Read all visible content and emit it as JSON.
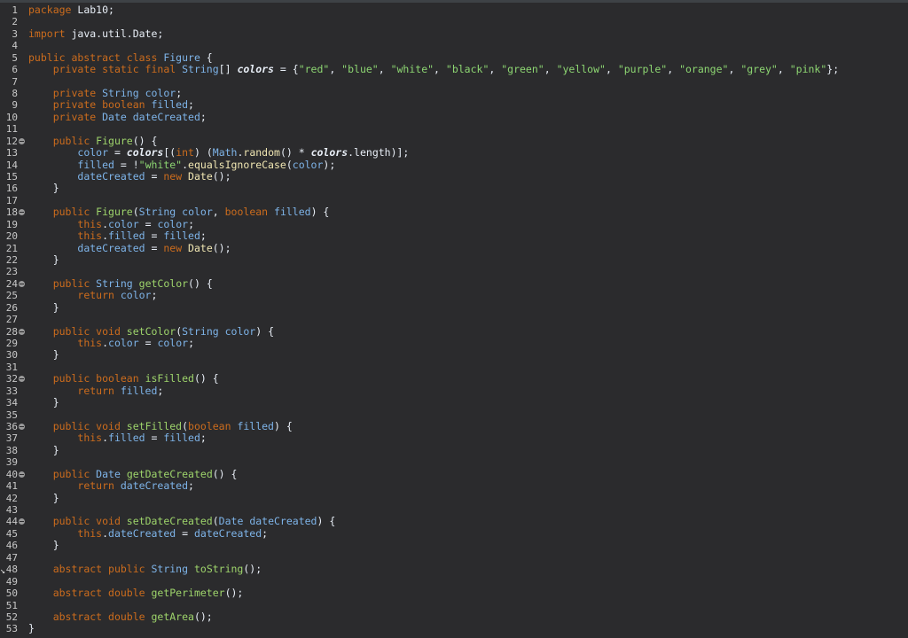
{
  "editor": {
    "lines": [
      {
        "n": "1",
        "fold": false,
        "indent": "",
        "segs": [
          [
            "kw",
            "package"
          ],
          [
            "plain",
            " Lab10;"
          ]
        ]
      },
      {
        "n": "2",
        "fold": false,
        "indent": "",
        "segs": []
      },
      {
        "n": "3",
        "fold": false,
        "indent": "",
        "segs": [
          [
            "kw",
            "import"
          ],
          [
            "plain",
            " java.util.Date;"
          ]
        ]
      },
      {
        "n": "4",
        "fold": false,
        "indent": "",
        "segs": []
      },
      {
        "n": "5",
        "fold": false,
        "indent": "",
        "segs": [
          [
            "kw",
            "public abstract class "
          ],
          [
            "type",
            "Figure"
          ],
          [
            "plain",
            " {"
          ]
        ]
      },
      {
        "n": "6",
        "fold": false,
        "indent": "    ",
        "segs": [
          [
            "kw",
            "private static final "
          ],
          [
            "type",
            "String"
          ],
          [
            "plain",
            "[] "
          ],
          [
            "sfield",
            "colors"
          ],
          [
            "plain",
            " = {"
          ],
          [
            "str",
            "\"red\""
          ],
          [
            "plain",
            ", "
          ],
          [
            "str",
            "\"blue\""
          ],
          [
            "plain",
            ", "
          ],
          [
            "str",
            "\"white\""
          ],
          [
            "plain",
            ", "
          ],
          [
            "str",
            "\"black\""
          ],
          [
            "plain",
            ", "
          ],
          [
            "str",
            "\"green\""
          ],
          [
            "plain",
            ", "
          ],
          [
            "str",
            "\"yellow\""
          ],
          [
            "plain",
            ", "
          ],
          [
            "str",
            "\"purple\""
          ],
          [
            "plain",
            ", "
          ],
          [
            "str",
            "\"orange\""
          ],
          [
            "plain",
            ", "
          ],
          [
            "str",
            "\"grey\""
          ],
          [
            "plain",
            ", "
          ],
          [
            "str",
            "\"pink\""
          ],
          [
            "plain",
            "};"
          ]
        ]
      },
      {
        "n": "7",
        "fold": false,
        "indent": "",
        "segs": []
      },
      {
        "n": "8",
        "fold": false,
        "indent": "    ",
        "segs": [
          [
            "kw",
            "private "
          ],
          [
            "type",
            "String"
          ],
          [
            "plain",
            " "
          ],
          [
            "var",
            "color"
          ],
          [
            "plain",
            ";"
          ]
        ]
      },
      {
        "n": "9",
        "fold": false,
        "indent": "    ",
        "segs": [
          [
            "kw",
            "private boolean "
          ],
          [
            "var",
            "filled"
          ],
          [
            "plain",
            ";"
          ]
        ]
      },
      {
        "n": "10",
        "fold": false,
        "indent": "    ",
        "segs": [
          [
            "kw",
            "private "
          ],
          [
            "type",
            "Date"
          ],
          [
            "plain",
            " "
          ],
          [
            "var",
            "dateCreated"
          ],
          [
            "plain",
            ";"
          ]
        ]
      },
      {
        "n": "11",
        "fold": false,
        "indent": "",
        "segs": []
      },
      {
        "n": "12",
        "fold": true,
        "indent": "    ",
        "segs": [
          [
            "kw",
            "public "
          ],
          [
            "fn",
            "Figure"
          ],
          [
            "plain",
            "() {"
          ]
        ]
      },
      {
        "n": "13",
        "fold": false,
        "indent": "        ",
        "segs": [
          [
            "var",
            "color"
          ],
          [
            "plain",
            " = "
          ],
          [
            "sfield",
            "colors"
          ],
          [
            "plain",
            "[("
          ],
          [
            "kw",
            "int"
          ],
          [
            "plain",
            ") ("
          ],
          [
            "type",
            "Math"
          ],
          [
            "plain",
            "."
          ],
          [
            "call",
            "random"
          ],
          [
            "plain",
            "() * "
          ],
          [
            "sfield",
            "colors"
          ],
          [
            "plain",
            ".length)];"
          ]
        ]
      },
      {
        "n": "14",
        "fold": false,
        "indent": "        ",
        "segs": [
          [
            "var",
            "filled"
          ],
          [
            "plain",
            " = !"
          ],
          [
            "str",
            "\"white\""
          ],
          [
            "plain",
            "."
          ],
          [
            "call",
            "equalsIgnoreCase"
          ],
          [
            "plain",
            "("
          ],
          [
            "var",
            "color"
          ],
          [
            "plain",
            ");"
          ]
        ]
      },
      {
        "n": "15",
        "fold": false,
        "indent": "        ",
        "segs": [
          [
            "var",
            "dateCreated"
          ],
          [
            "plain",
            " = "
          ],
          [
            "kw",
            "new "
          ],
          [
            "call",
            "Date"
          ],
          [
            "plain",
            "();"
          ]
        ]
      },
      {
        "n": "16",
        "fold": false,
        "indent": "    ",
        "segs": [
          [
            "plain",
            "}"
          ]
        ]
      },
      {
        "n": "17",
        "fold": false,
        "indent": "",
        "segs": []
      },
      {
        "n": "18",
        "fold": true,
        "indent": "    ",
        "segs": [
          [
            "kw",
            "public "
          ],
          [
            "fn",
            "Figure"
          ],
          [
            "plain",
            "("
          ],
          [
            "type",
            "String"
          ],
          [
            "plain",
            " "
          ],
          [
            "var",
            "color"
          ],
          [
            "plain",
            ", "
          ],
          [
            "kw",
            "boolean "
          ],
          [
            "var",
            "filled"
          ],
          [
            "plain",
            ") {"
          ]
        ]
      },
      {
        "n": "19",
        "fold": false,
        "indent": "        ",
        "segs": [
          [
            "kw",
            "this"
          ],
          [
            "plain",
            "."
          ],
          [
            "var",
            "color"
          ],
          [
            "plain",
            " = "
          ],
          [
            "var",
            "color"
          ],
          [
            "plain",
            ";"
          ]
        ]
      },
      {
        "n": "20",
        "fold": false,
        "indent": "        ",
        "segs": [
          [
            "kw",
            "this"
          ],
          [
            "plain",
            "."
          ],
          [
            "var",
            "filled"
          ],
          [
            "plain",
            " = "
          ],
          [
            "var",
            "filled"
          ],
          [
            "plain",
            ";"
          ]
        ]
      },
      {
        "n": "21",
        "fold": false,
        "indent": "        ",
        "segs": [
          [
            "var",
            "dateCreated"
          ],
          [
            "plain",
            " = "
          ],
          [
            "kw",
            "new "
          ],
          [
            "call",
            "Date"
          ],
          [
            "plain",
            "();"
          ]
        ]
      },
      {
        "n": "22",
        "fold": false,
        "indent": "    ",
        "segs": [
          [
            "plain",
            "}"
          ]
        ]
      },
      {
        "n": "23",
        "fold": false,
        "indent": "",
        "segs": []
      },
      {
        "n": "24",
        "fold": true,
        "indent": "    ",
        "segs": [
          [
            "kw",
            "public "
          ],
          [
            "type",
            "String"
          ],
          [
            "plain",
            " "
          ],
          [
            "fn",
            "getColor"
          ],
          [
            "plain",
            "() {"
          ]
        ]
      },
      {
        "n": "25",
        "fold": false,
        "indent": "        ",
        "segs": [
          [
            "kw",
            "return "
          ],
          [
            "var",
            "color"
          ],
          [
            "plain",
            ";"
          ]
        ]
      },
      {
        "n": "26",
        "fold": false,
        "indent": "    ",
        "segs": [
          [
            "plain",
            "}"
          ]
        ]
      },
      {
        "n": "27",
        "fold": false,
        "indent": "",
        "segs": []
      },
      {
        "n": "28",
        "fold": true,
        "indent": "    ",
        "segs": [
          [
            "kw",
            "public void "
          ],
          [
            "fn",
            "setColor"
          ],
          [
            "plain",
            "("
          ],
          [
            "type",
            "String"
          ],
          [
            "plain",
            " "
          ],
          [
            "var",
            "color"
          ],
          [
            "plain",
            ") {"
          ]
        ]
      },
      {
        "n": "29",
        "fold": false,
        "indent": "        ",
        "segs": [
          [
            "kw",
            "this"
          ],
          [
            "plain",
            "."
          ],
          [
            "var",
            "color"
          ],
          [
            "plain",
            " = "
          ],
          [
            "var",
            "color"
          ],
          [
            "plain",
            ";"
          ]
        ]
      },
      {
        "n": "30",
        "fold": false,
        "indent": "    ",
        "segs": [
          [
            "plain",
            "}"
          ]
        ]
      },
      {
        "n": "31",
        "fold": false,
        "indent": "",
        "segs": []
      },
      {
        "n": "32",
        "fold": true,
        "indent": "    ",
        "segs": [
          [
            "kw",
            "public boolean "
          ],
          [
            "fn",
            "isFilled"
          ],
          [
            "plain",
            "() {"
          ]
        ]
      },
      {
        "n": "33",
        "fold": false,
        "indent": "        ",
        "segs": [
          [
            "kw",
            "return "
          ],
          [
            "var",
            "filled"
          ],
          [
            "plain",
            ";"
          ]
        ]
      },
      {
        "n": "34",
        "fold": false,
        "indent": "    ",
        "segs": [
          [
            "plain",
            "}"
          ]
        ]
      },
      {
        "n": "35",
        "fold": false,
        "indent": "",
        "segs": []
      },
      {
        "n": "36",
        "fold": true,
        "indent": "    ",
        "segs": [
          [
            "kw",
            "public void "
          ],
          [
            "fn",
            "setFilled"
          ],
          [
            "plain",
            "("
          ],
          [
            "kw",
            "boolean "
          ],
          [
            "var",
            "filled"
          ],
          [
            "plain",
            ") {"
          ]
        ]
      },
      {
        "n": "37",
        "fold": false,
        "indent": "        ",
        "segs": [
          [
            "kw",
            "this"
          ],
          [
            "plain",
            "."
          ],
          [
            "var",
            "filled"
          ],
          [
            "plain",
            " = "
          ],
          [
            "var",
            "filled"
          ],
          [
            "plain",
            ";"
          ]
        ]
      },
      {
        "n": "38",
        "fold": false,
        "indent": "    ",
        "segs": [
          [
            "plain",
            "}"
          ]
        ]
      },
      {
        "n": "39",
        "fold": false,
        "indent": "",
        "segs": []
      },
      {
        "n": "40",
        "fold": true,
        "indent": "    ",
        "segs": [
          [
            "kw",
            "public "
          ],
          [
            "type",
            "Date"
          ],
          [
            "plain",
            " "
          ],
          [
            "fn",
            "getDateCreated"
          ],
          [
            "plain",
            "() {"
          ]
        ]
      },
      {
        "n": "41",
        "fold": false,
        "indent": "        ",
        "segs": [
          [
            "kw",
            "return "
          ],
          [
            "var",
            "dateCreated"
          ],
          [
            "plain",
            ";"
          ]
        ]
      },
      {
        "n": "42",
        "fold": false,
        "indent": "    ",
        "segs": [
          [
            "plain",
            "}"
          ]
        ]
      },
      {
        "n": "43",
        "fold": false,
        "indent": "",
        "segs": []
      },
      {
        "n": "44",
        "fold": true,
        "indent": "    ",
        "segs": [
          [
            "kw",
            "public void "
          ],
          [
            "fn",
            "setDateCreated"
          ],
          [
            "plain",
            "("
          ],
          [
            "type",
            "Date"
          ],
          [
            "plain",
            " "
          ],
          [
            "var",
            "dateCreated"
          ],
          [
            "plain",
            ") {"
          ]
        ]
      },
      {
        "n": "45",
        "fold": false,
        "indent": "        ",
        "segs": [
          [
            "kw",
            "this"
          ],
          [
            "plain",
            "."
          ],
          [
            "var",
            "dateCreated"
          ],
          [
            "plain",
            " = "
          ],
          [
            "var",
            "dateCreated"
          ],
          [
            "plain",
            ";"
          ]
        ]
      },
      {
        "n": "46",
        "fold": false,
        "indent": "    ",
        "segs": [
          [
            "plain",
            "}"
          ]
        ]
      },
      {
        "n": "47",
        "fold": false,
        "indent": "",
        "segs": []
      },
      {
        "n": "48",
        "fold": false,
        "indent": "    ",
        "segs": [
          [
            "kw",
            "abstract public "
          ],
          [
            "type",
            "String"
          ],
          [
            "plain",
            " "
          ],
          [
            "fn",
            "toString"
          ],
          [
            "plain",
            "();"
          ]
        ]
      },
      {
        "n": "49",
        "fold": false,
        "indent": "",
        "segs": []
      },
      {
        "n": "50",
        "fold": false,
        "indent": "    ",
        "segs": [
          [
            "kw",
            "abstract double "
          ],
          [
            "fn",
            "getPerimeter"
          ],
          [
            "plain",
            "();"
          ]
        ]
      },
      {
        "n": "51",
        "fold": false,
        "indent": "",
        "segs": []
      },
      {
        "n": "52",
        "fold": false,
        "indent": "    ",
        "segs": [
          [
            "kw",
            "abstract double "
          ],
          [
            "fn",
            "getArea"
          ],
          [
            "plain",
            "();"
          ]
        ]
      },
      {
        "n": "53",
        "fold": false,
        "indent": "",
        "segs": [
          [
            "plain",
            "}"
          ]
        ]
      }
    ]
  },
  "colors": {
    "background": "#2b2b2d",
    "keyword": "#cc6c1d",
    "type": "#7eb4e9",
    "string": "#8dd672",
    "method": "#9ed46b"
  }
}
